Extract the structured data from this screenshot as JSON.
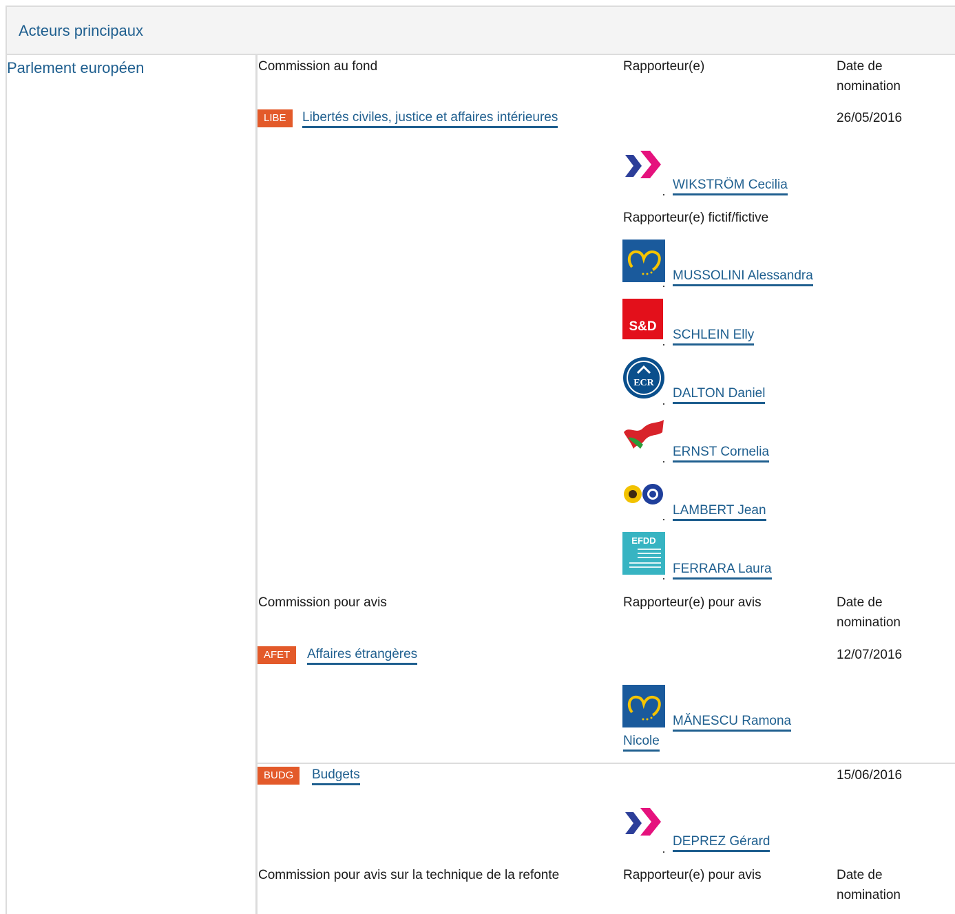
{
  "header": {
    "title": "Acteurs principaux"
  },
  "left": {
    "institution": "Parlement européen"
  },
  "section1": {
    "col_committee": "Commission au fond",
    "col_rapporteur": "Rapporteur(e)",
    "col_date": "Date de nomination",
    "committee_code": "LIBE",
    "committee_name": "Libertés civiles, justice et affaires intérieures",
    "date": "26/05/2016",
    "rapporteur": {
      "name": "WIKSTRÖM Cecilia",
      "group_icon": "alde-logo-icon"
    },
    "shadow_label": "Rapporteur(e) fictif/fictive",
    "shadows": [
      {
        "name": "MUSSOLINI Alessandra",
        "group_icon": "epp-logo-icon"
      },
      {
        "name": "SCHLEIN Elly",
        "group_icon": "sd-logo-icon",
        "logo_text": "S&D"
      },
      {
        "name": "DALTON Daniel",
        "group_icon": "ecr-logo-icon",
        "logo_text": "ECR"
      },
      {
        "name": "ERNST Cornelia",
        "group_icon": "gue-ngl-logo-icon"
      },
      {
        "name": "LAMBERT Jean",
        "group_icon": "greens-efa-logo-icon"
      },
      {
        "name": "FERRARA Laura",
        "group_icon": "efdd-logo-icon",
        "logo_text": "EFDD"
      }
    ]
  },
  "section2": {
    "col_committee": "Commission pour avis",
    "col_rapporteur": "Rapporteur(e) pour avis",
    "col_date": "Date de nomination",
    "committees": [
      {
        "code": "AFET",
        "name": "Affaires étrangères",
        "date": "12/07/2016",
        "rapporteur": {
          "name_line1": "MĂNESCU Ramona",
          "name_line2": "Nicole",
          "group_icon": "epp-logo-icon"
        }
      },
      {
        "code": "BUDG",
        "name": "Budgets",
        "date": "15/06/2016",
        "rapporteur": {
          "name": "DEPREZ Gérard",
          "group_icon": "alde-logo-icon"
        }
      }
    ]
  },
  "section3": {
    "col_committee": "Commission pour avis sur la technique de la refonte",
    "col_rapporteur": "Rapporteur(e) pour avis",
    "col_date": "Date de nomination"
  },
  "colors": {
    "link": "#1f5f8f",
    "badge": "#e35a2a",
    "border": "#dcdcdc",
    "header_bg": "#f4f4f4"
  }
}
